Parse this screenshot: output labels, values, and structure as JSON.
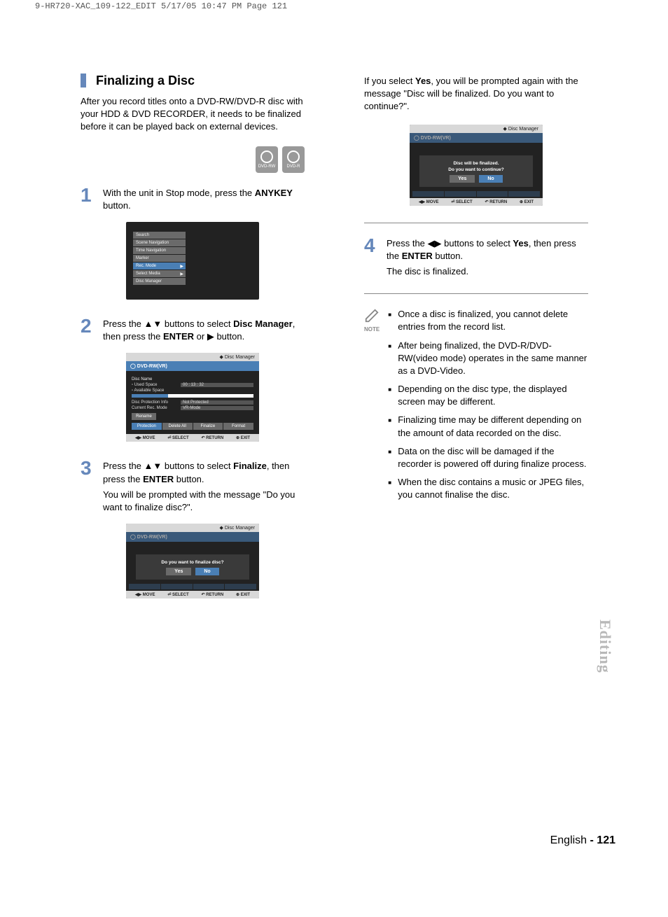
{
  "crop_header": "9-HR720-XAC_109-122_EDIT  5/17/05  10:47 PM  Page 121",
  "heading": "Finalizing a Disc",
  "intro": "After you record titles onto a DVD-RW/DVD-R disc with your HDD & DVD RECORDER, it needs to be finalized before it can be played back on external devices.",
  "disc_labels": {
    "rw": "DVD-RW",
    "r": "DVD-R"
  },
  "step1": {
    "pre": "With the unit in Stop mode, press the ",
    "bold": "ANYKEY",
    "post": " button."
  },
  "screen1": {
    "items": [
      "Search",
      "Scene Navigation",
      "Time Navigation",
      "Marker",
      "Rec. Mode",
      "Select Media",
      "Disc Manager"
    ],
    "hl_index": 4
  },
  "step2": {
    "pre": "Press the ▲▼ buttons to select ",
    "bold": "Disc Manager",
    "mid": ", then press the ",
    "bold2": "ENTER",
    "post": " or ▶ button."
  },
  "screen2": {
    "title": "Disc Manager",
    "sub": "DVD-RW(VR)",
    "disc_name_label": "Disc Name",
    "used_label": "Used Space",
    "used_value": "00 : 13 : 32",
    "avail_label": "Available Space",
    "prot_label": "Disc Protection Info",
    "prot_value": "Not Protected",
    "mode_label": "Current Rec. Mode",
    "mode_value": "VR-Mode",
    "rename": "Rename",
    "buttons": [
      "Protection",
      "Delete All",
      "Finalize",
      "Format"
    ],
    "hl_index": 0,
    "guide": [
      "◀▶ MOVE",
      "⏎ SELECT",
      "↶ RETURN",
      "⊕ EXIT"
    ]
  },
  "step3": {
    "pre": "Press the ▲▼ buttons to select ",
    "bold": "Finalize",
    "mid": ", then press the ",
    "bold2": "ENTER",
    "post": " button.",
    "follow": "You will be prompted with the message \"Do you want to finalize disc?\"."
  },
  "screen3": {
    "title": "Disc Manager",
    "sub": "DVD-RW(VR)",
    "dialog": "Do you want to finalize disc?",
    "yes": "Yes",
    "no": "No",
    "guide": [
      "◀▶ MOVE",
      "⏎ SELECT",
      "↶ RETURN",
      "⊕ EXIT"
    ]
  },
  "right_intro_pre": "If you select ",
  "right_intro_bold": "Yes",
  "right_intro_post": ", you will be prompted again with the message \"Disc will be finalized. Do you want to continue?\".",
  "screen4": {
    "title": "Disc Manager",
    "sub": "DVD-RW(VR)",
    "line1": "Disc will be finalized.",
    "line2": "Do you want to continue?",
    "yes": "Yes",
    "no": "No",
    "guide": [
      "◀▶ MOVE",
      "⏎ SELECT",
      "↶ RETURN",
      "⊕ EXIT"
    ]
  },
  "step4": {
    "pre": "Press the ◀▶ buttons to select ",
    "bold": "Yes",
    "mid": ", then press the ",
    "bold2": "ENTER",
    "post": " button.",
    "follow": "The disc is finalized."
  },
  "note_label": "NOTE",
  "notes": [
    "Once a disc is finalized, you cannot delete entries from the record list.",
    "After being finalized, the DVD-R/DVD-RW(video mode) operates in the same manner as a DVD-Video.",
    "Depending on the disc type, the displayed screen may be different.",
    "Finalizing time may be different depending on the amount of data recorded on the disc.",
    "Data on the disc will be damaged if the recorder is powered off during finalize process.",
    "When the disc contains a music or JPEG files, you cannot finalise the disc."
  ],
  "section_tab": "Editing",
  "footer_lang": "English ",
  "footer_dash": "- ",
  "footer_num": "121"
}
